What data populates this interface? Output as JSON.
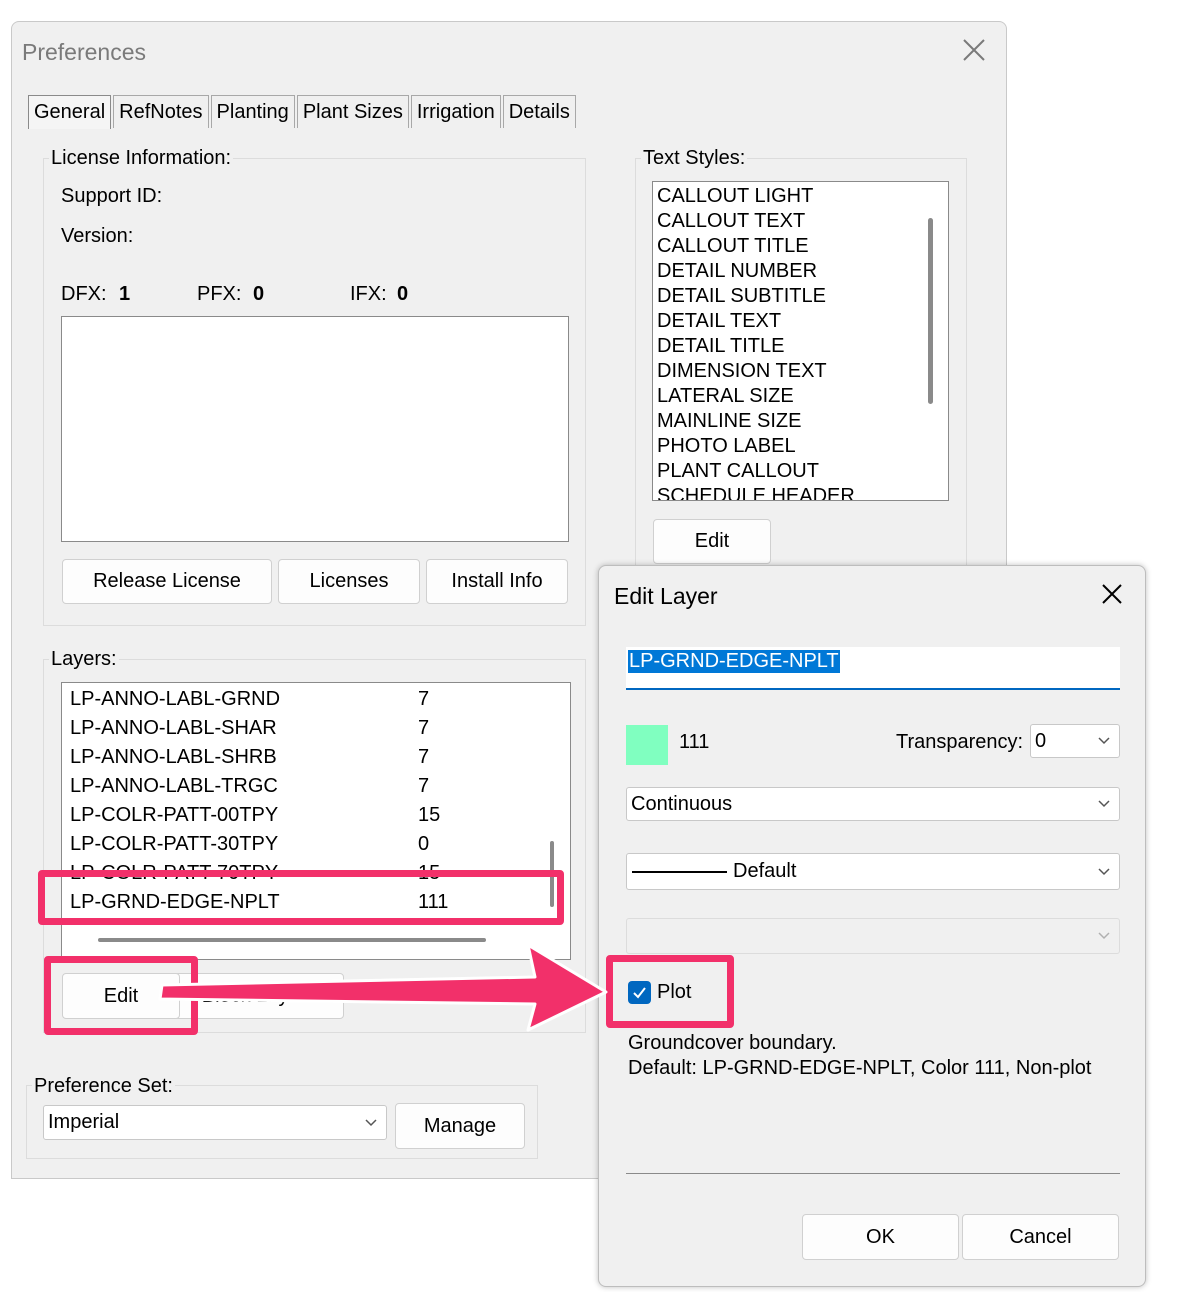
{
  "preferences": {
    "title": "Preferences",
    "tabs": [
      "General",
      "RefNotes",
      "Planting",
      "Plant Sizes",
      "Irrigation",
      "Details"
    ],
    "license": {
      "label": "License Information:",
      "support_id": "Support ID:",
      "version": "Version:",
      "dfx_label": "DFX:",
      "dfx_value": "1",
      "pfx_label": "PFX:",
      "pfx_value": "0",
      "ifx_label": "IFX:",
      "ifx_value": "0",
      "buttons": {
        "release": "Release License",
        "licenses": "Licenses",
        "install": "Install Info"
      }
    },
    "text_styles": {
      "label": "Text Styles:",
      "items": [
        "CALLOUT LIGHT",
        "CALLOUT TEXT",
        "CALLOUT TITLE",
        "DETAIL NUMBER",
        "DETAIL SUBTITLE",
        "DETAIL TEXT",
        "DETAIL TITLE",
        "DIMENSION TEXT",
        "LATERAL SIZE",
        "MAINLINE SIZE",
        "PHOTO LABEL",
        "PLANT CALLOUT",
        "SCHEDULE HEADER"
      ],
      "edit_button": "Edit"
    },
    "layers": {
      "label": "Layers:",
      "rows": [
        {
          "name": "LP-ANNO-LABL-GRND",
          "color": "7"
        },
        {
          "name": "LP-ANNO-LABL-SHAR",
          "color": "7"
        },
        {
          "name": "LP-ANNO-LABL-SHRB",
          "color": "7"
        },
        {
          "name": "LP-ANNO-LABL-TRGC",
          "color": "7"
        },
        {
          "name": "LP-COLR-PATT-00TPY",
          "color": "15"
        },
        {
          "name": "LP-COLR-PATT-30TPY",
          "color": "0"
        },
        {
          "name": "LP-COLR-PATT-70TPY",
          "color": "15"
        },
        {
          "name": "LP-GRND-EDGE-NPLT",
          "color": "111"
        }
      ],
      "edit_button": "Edit",
      "block_layers_button": "Block Layers"
    },
    "preference_set": {
      "label": "Preference Set:",
      "value": "Imperial",
      "manage_button": "Manage"
    }
  },
  "edit_layer": {
    "title": "Edit Layer",
    "layer_name": "LP-GRND-EDGE-NPLT",
    "color_value": "111",
    "swatch_color": "#80ffc0",
    "transparency_label": "Transparency:",
    "transparency_value": "0",
    "linetype": "Continuous",
    "lineweight": "Default",
    "plot_label": "Plot",
    "plot_checked": true,
    "description_line1": "Groundcover boundary.",
    "description_line2": "Default: LP-GRND-EDGE-NPLT, Color 111, Non-plot",
    "ok_button": "OK",
    "cancel_button": "Cancel"
  },
  "annotation": {
    "highlight_color": "#f2306a"
  }
}
